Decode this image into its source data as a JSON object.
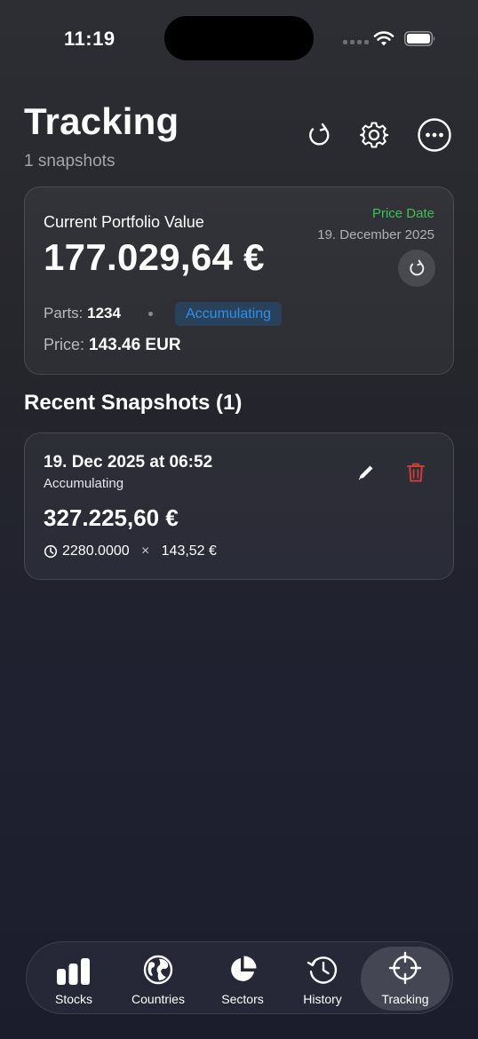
{
  "status_bar": {
    "time": "11:19"
  },
  "header": {
    "title": "Tracking",
    "subtitle": "1 snapshots"
  },
  "portfolio": {
    "label": "Current Portfolio Value",
    "value": "177.029,64 €",
    "price_date_label": "Price Date",
    "price_date": "19. December 2025",
    "parts_label": "Parts:",
    "parts_value": "1234",
    "badge": "Accumulating",
    "price_label": "Price:",
    "price_value": "143.46 EUR"
  },
  "recent": {
    "title": "Recent Snapshots (1)",
    "snapshots": [
      {
        "date": "19. Dec 2025 at 06:52",
        "type": "Accumulating",
        "value": "327.225,60 €",
        "shares": "2280.0000",
        "times": "×",
        "price": "143,52 €"
      }
    ]
  },
  "tabs": [
    {
      "label": "Stocks",
      "icon": "bar-chart-icon"
    },
    {
      "label": "Countries",
      "icon": "globe-icon"
    },
    {
      "label": "Sectors",
      "icon": "pie-chart-icon"
    },
    {
      "label": "History",
      "icon": "history-icon"
    },
    {
      "label": "Tracking",
      "icon": "target-icon",
      "active": true
    }
  ],
  "colors": {
    "accent_green": "#3fbf5a",
    "badge_blue": "#2f8fe8",
    "delete_red": "#c9403a"
  }
}
